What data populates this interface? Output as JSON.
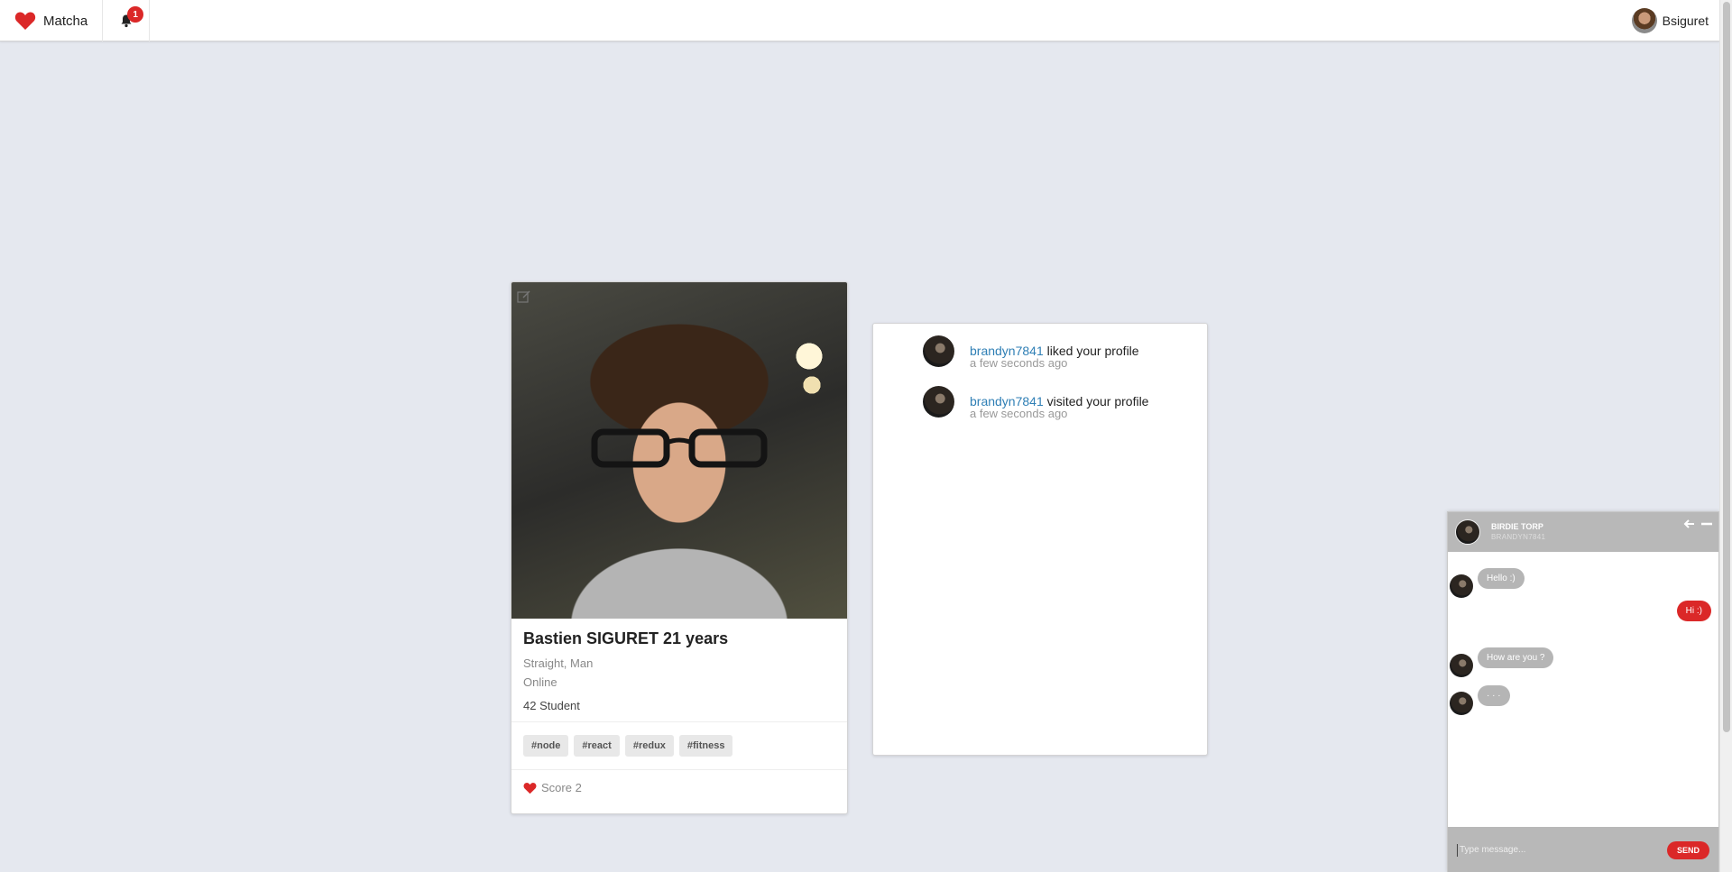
{
  "navbar": {
    "brand": "Matcha",
    "notification_count": "1",
    "username": "Bsiguret"
  },
  "profile": {
    "name_age": "Bastien SIGURET 21 years",
    "orientation_gender": "Straight, Man",
    "status": "Online",
    "bio": "42 Student",
    "tags": [
      "#node",
      "#react",
      "#redux",
      "#fitness"
    ],
    "score_label": "Score 2"
  },
  "notifications": [
    {
      "user": "brandyn7841",
      "action": "liked your profile",
      "time": "a few seconds ago"
    },
    {
      "user": "brandyn7841",
      "action": "visited your profile",
      "time": "a few seconds ago"
    }
  ],
  "chat": {
    "contact_name": "BIRDIE TORP",
    "contact_username": "BRANDYN7841",
    "messages": [
      {
        "from": "them",
        "text": "Hello :)"
      },
      {
        "from": "me",
        "text": "Hi :)"
      },
      {
        "from": "them",
        "text": "How are you ?"
      },
      {
        "from": "them",
        "text": "· · ·"
      }
    ],
    "input_placeholder": "Type message...",
    "send_label": "SEND"
  },
  "colors": {
    "accent_red": "#db2828",
    "link_blue": "#2f7fb5",
    "page_bg": "#e5e8ef"
  }
}
